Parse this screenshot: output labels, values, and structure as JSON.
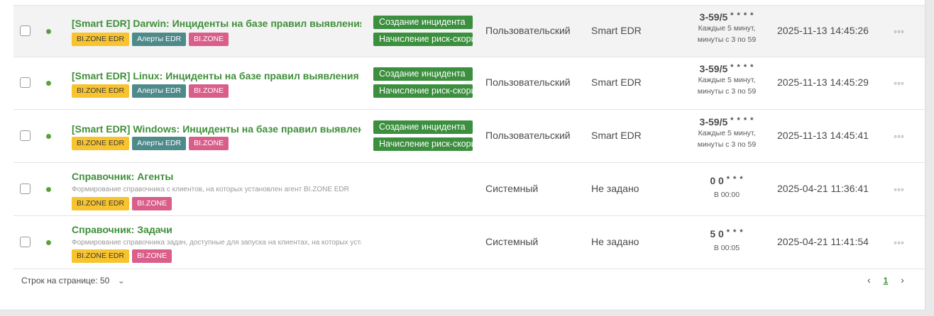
{
  "rows": [
    {
      "title": "[Smart EDR] Darwin: Инциденты на базе правил выявления угроз",
      "tags": [
        "BI.ZONE EDR",
        "Алерты EDR",
        "BI.ZONE"
      ],
      "actions": [
        "Создание инцидента",
        "Начисление риск-скоринга"
      ],
      "type": "Пользовательский",
      "source": "Smart EDR",
      "schedule_expr": "3-59/5",
      "schedule_stars": "* * * *",
      "schedule_desc_1": "Каждые 5 минут,",
      "schedule_desc_2": "минуты с 3 по 59",
      "datetime": "2025-11-13 14:45:26",
      "more": "◦◦◦"
    },
    {
      "title": "[Smart EDR] Linux: Инциденты на базе правил выявления угроз",
      "tags": [
        "BI.ZONE EDR",
        "Алерты EDR",
        "BI.ZONE"
      ],
      "actions": [
        "Создание инцидента",
        "Начисление риск-скоринга"
      ],
      "type": "Пользовательский",
      "source": "Smart EDR",
      "schedule_expr": "3-59/5",
      "schedule_stars": "* * * *",
      "schedule_desc_1": "Каждые 5 минут,",
      "schedule_desc_2": "минуты с 3 по 59",
      "datetime": "2025-11-13 14:45:29",
      "more": "◦◦◦"
    },
    {
      "title": "[Smart EDR] Windows: Инциденты на базе правил выявления угроз",
      "tags": [
        "BI.ZONE EDR",
        "Алерты EDR",
        "BI.ZONE"
      ],
      "actions": [
        "Создание инцидента",
        "Начисление риск-скоринга"
      ],
      "type": "Пользовательский",
      "source": "Smart EDR",
      "schedule_expr": "3-59/5",
      "schedule_stars": "* * * *",
      "schedule_desc_1": "Каждые 5 минут,",
      "schedule_desc_2": "минуты с 3 по 59",
      "datetime": "2025-11-13 14:45:41",
      "more": "◦◦◦"
    },
    {
      "title": "Справочник: Агенты",
      "description": "Формирование справочника с клиентов, на которых установлен агент BI.ZONE EDR",
      "tags": [
        "BI.ZONE EDR",
        "BI.ZONE"
      ],
      "type": "Системный",
      "source": "Не задано",
      "schedule_expr": "0 0",
      "schedule_stars": "* * *",
      "schedule_desc_1": "В 00:00",
      "datetime": "2025-04-21 11:36:41",
      "more": "◦◦◦"
    },
    {
      "title": "Справочник: Задачи",
      "description": "Формирование справочника задач, доступные для запуска на клиентах, на которых установлен агент",
      "tags": [
        "BI.ZONE EDR",
        "BI.ZONE"
      ],
      "type": "Системный",
      "source": "Не задано",
      "schedule_expr": "5 0",
      "schedule_stars": "* * *",
      "schedule_desc_1": "В 00:05",
      "datetime": "2025-04-21 11:41:54",
      "more": "◦◦◦"
    }
  ],
  "footer": {
    "rows_per_page_label": "Строк на странице: 50",
    "chevron": "⌄"
  },
  "pager": {
    "prev": "‹",
    "page": "1",
    "next": "›"
  },
  "colors": {
    "accent_green": "#3f8f3a",
    "action_green": "#3b8f3e",
    "tag_yellow": "#f7c32e",
    "tag_teal": "#4f8a8b",
    "tag_pink": "#d95f8a",
    "status_dot": "#5aa13d"
  }
}
